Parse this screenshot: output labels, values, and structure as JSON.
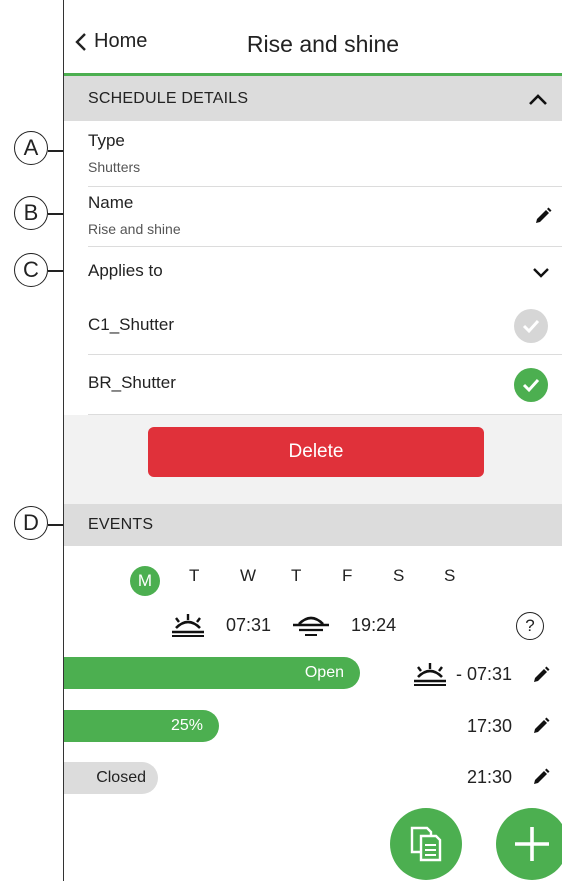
{
  "header": {
    "back_label": "Home",
    "title": "Rise and shine"
  },
  "callouts": [
    "A",
    "B",
    "C",
    "D"
  ],
  "schedule_details": {
    "section_label": "SCHEDULE DETAILS",
    "type": {
      "label": "Type",
      "value": "Shutters"
    },
    "name": {
      "label": "Name",
      "value": "Rise and shine"
    },
    "applies_to": {
      "label": "Applies to",
      "devices": [
        {
          "name": "C1_Shutter",
          "selected": false
        },
        {
          "name": "BR_Shutter",
          "selected": true
        }
      ]
    },
    "delete_label": "Delete"
  },
  "events": {
    "section_label": "EVENTS",
    "days": [
      "M",
      "T",
      "W",
      "T",
      "F",
      "S",
      "S"
    ],
    "active_day": "M",
    "sunrise_time": "07:31",
    "sunset_time": "19:24",
    "items": [
      {
        "state_label": "Open",
        "level": 1.0,
        "time": "- 07:31",
        "trigger": "sunrise"
      },
      {
        "state_label": "25%",
        "level": 0.25,
        "time": "17:30",
        "trigger": "time"
      },
      {
        "state_label": "Closed",
        "level": 0.0,
        "time": "21:30",
        "trigger": "time"
      }
    ]
  },
  "colors": {
    "accent": "#4caf50",
    "danger": "#e0313a",
    "section_bg": "#dcdcdc",
    "inactive_check": "#d6d6d6"
  },
  "icons": {
    "back": "chevron-left-icon",
    "edit": "pencil-icon",
    "copy": "copy-icon",
    "add": "plus-icon"
  }
}
